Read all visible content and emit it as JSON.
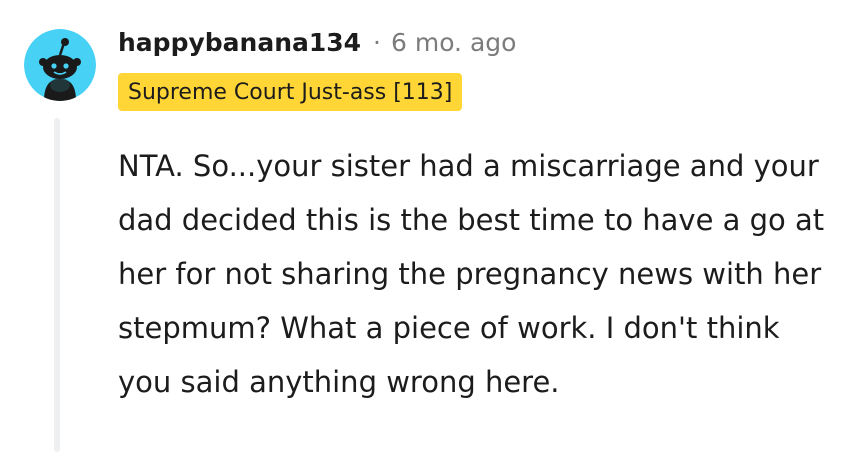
{
  "comment": {
    "avatar_icon": "snoo-avatar-icon",
    "avatar_bg": "#46d1f5",
    "username": "happybanana134",
    "separator": "·",
    "timestamp": "6 mo. ago",
    "flair": {
      "text": "Supreme Court Just-ass [113]",
      "bg_color": "#ffd635"
    },
    "body": "NTA. So...your sister had a miscarriage and your dad decided this is the best time to have a go at her for not sharing the pregnancy news with her stepmum? What a piece of work. I don't think you said anything wrong here."
  }
}
